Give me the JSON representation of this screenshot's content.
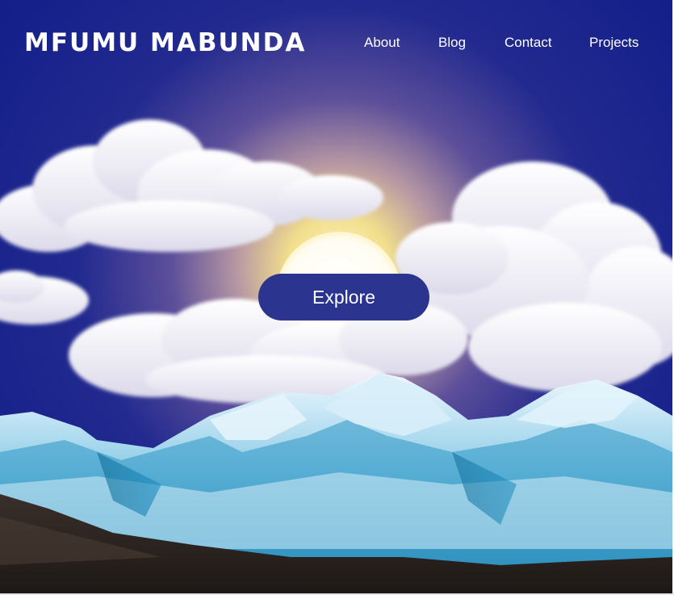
{
  "header": {
    "brand": "MFUMU MABUNDA"
  },
  "nav": {
    "items": [
      {
        "label": "About"
      },
      {
        "label": "Blog"
      },
      {
        "label": "Contact"
      },
      {
        "label": "Projects"
      }
    ]
  },
  "hero": {
    "cta_label": "Explore",
    "illustration": "sunset-mountains-clouds-illustration"
  },
  "colors": {
    "sky_top": "#141f8a",
    "sun_glow": "#f1e28a",
    "button_bg": "#2b3590",
    "text": "#ffffff"
  }
}
